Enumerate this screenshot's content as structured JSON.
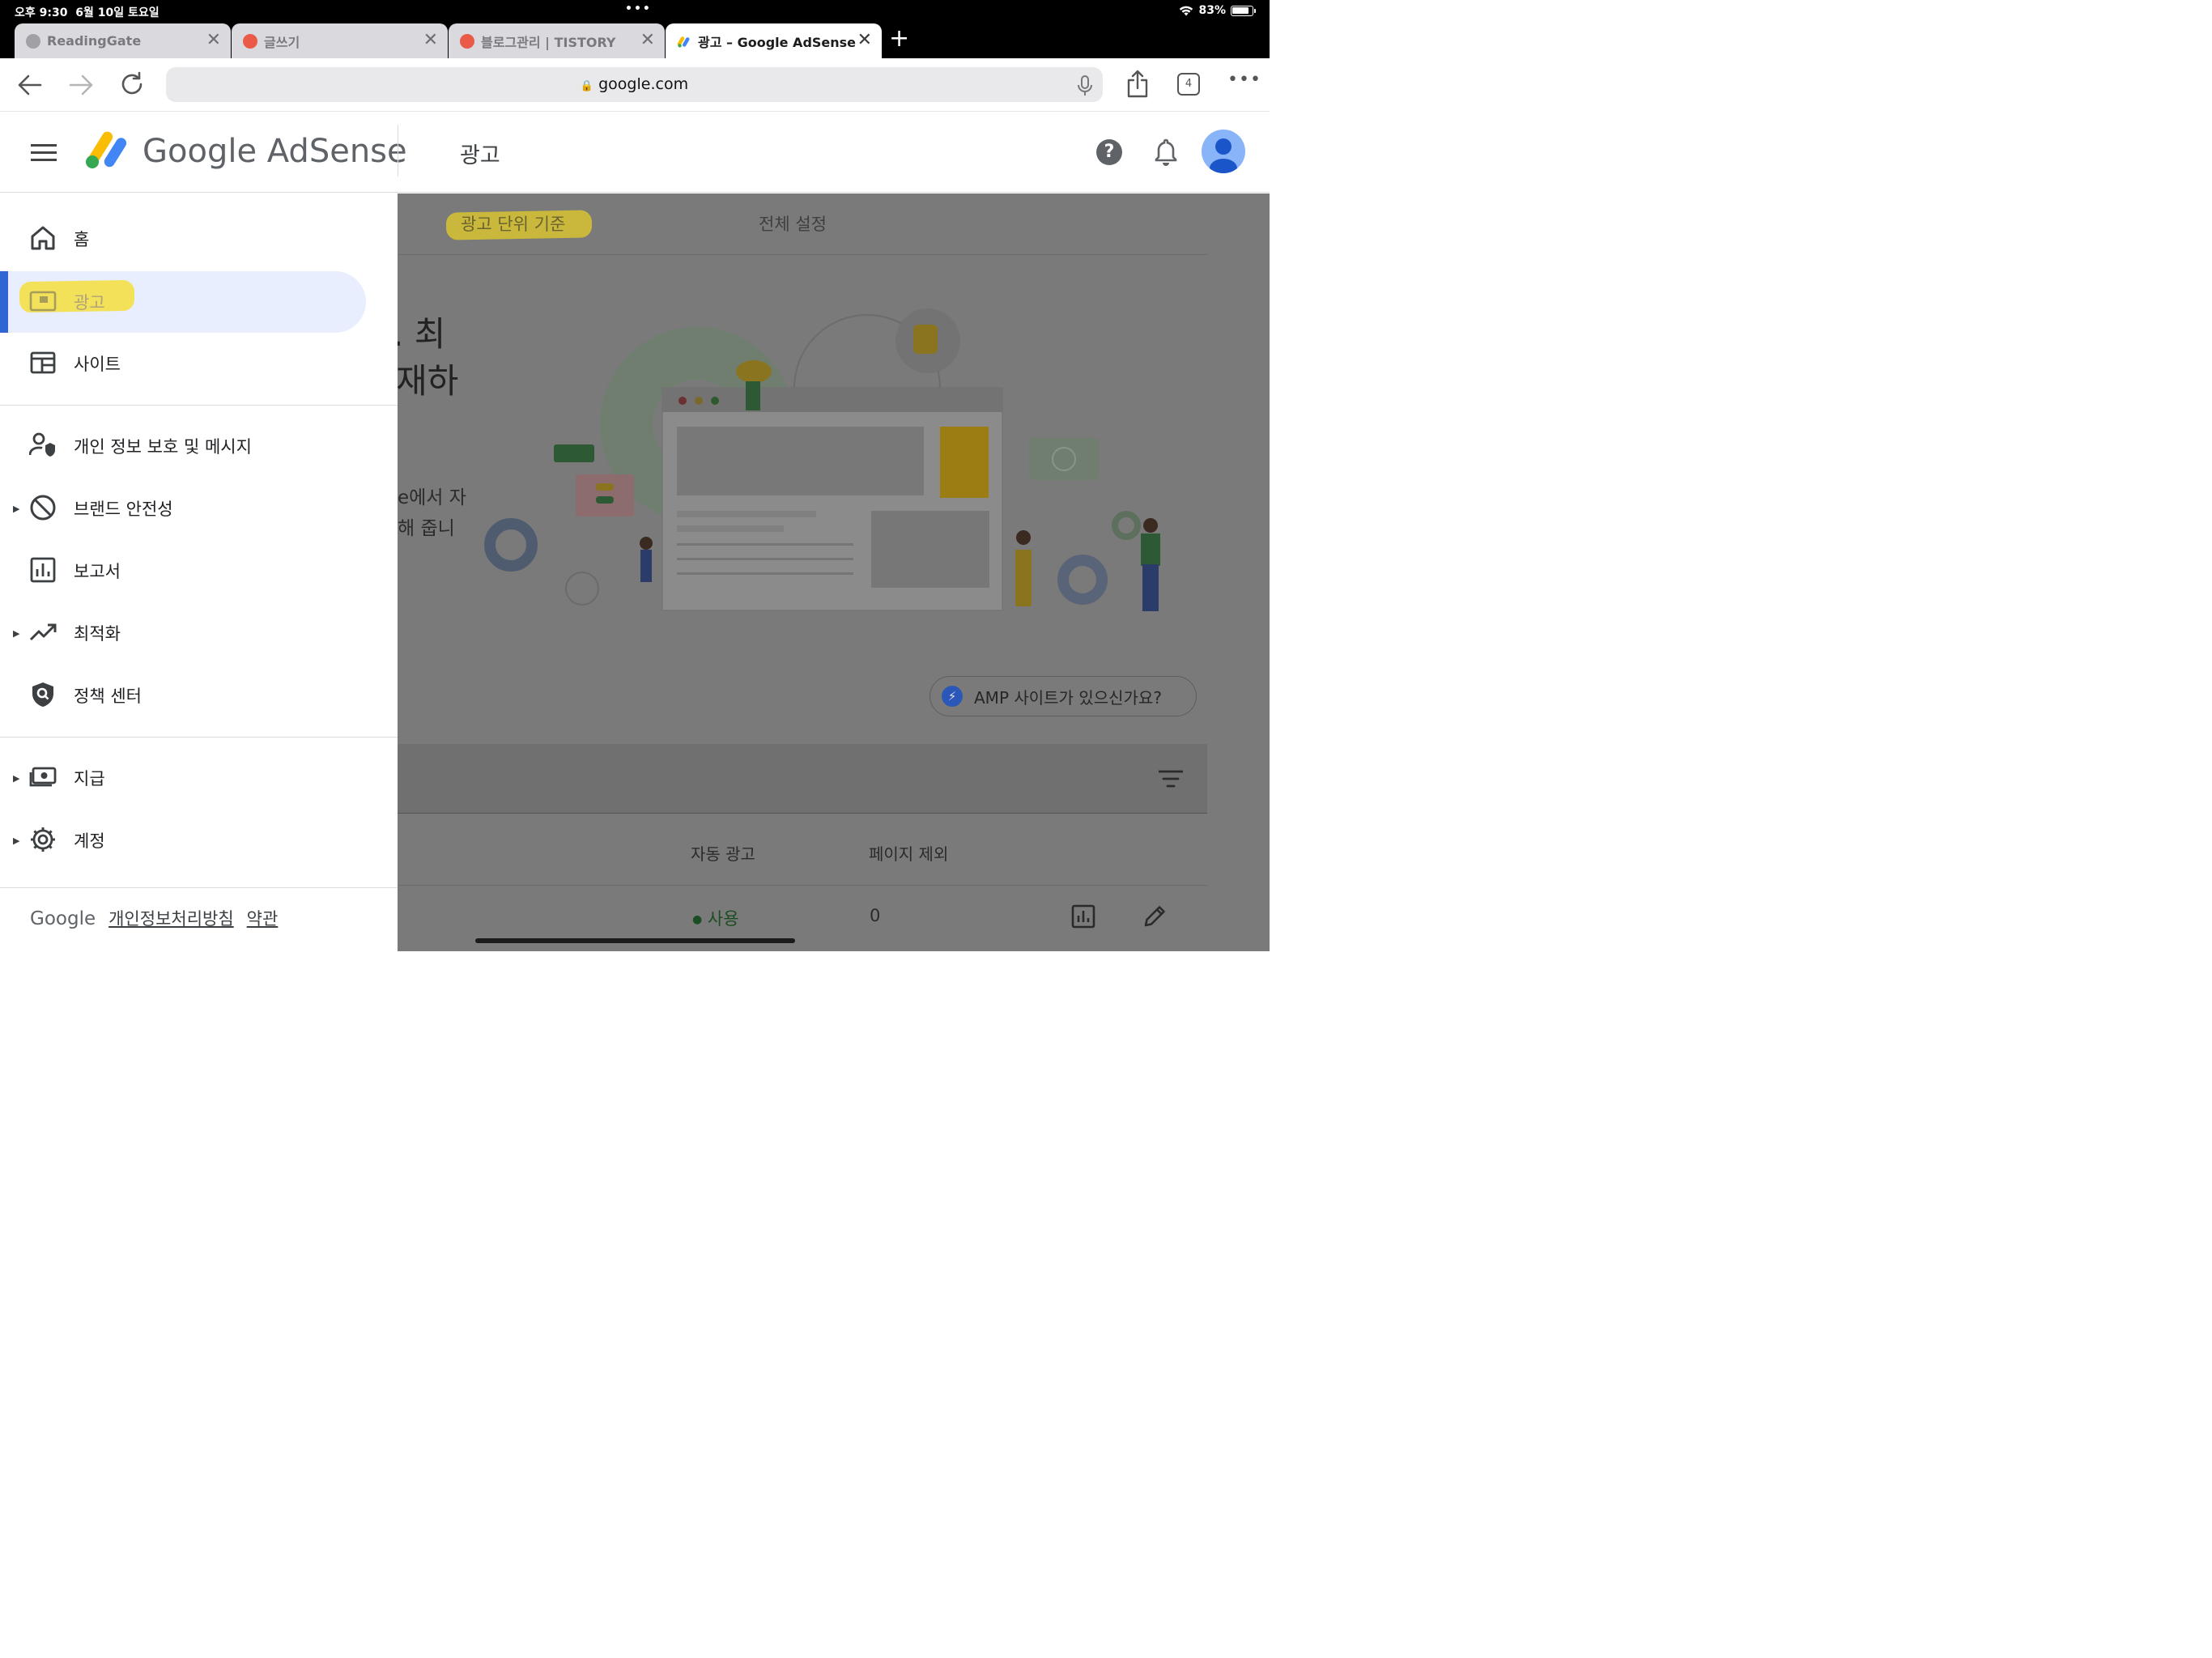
{
  "status_bar": {
    "time": "오후 9:30",
    "date": "6월 10일 토요일",
    "battery": "83%",
    "dots": "•••"
  },
  "browser_tabs": [
    {
      "title": "ReadingGate",
      "favicon": "globe-icon",
      "active": false
    },
    {
      "title": "글쓰기",
      "favicon": "tistory-icon",
      "active": false
    },
    {
      "title": "블로그관리 | TISTORY",
      "favicon": "tistory-icon",
      "active": false
    },
    {
      "title": "광고 – Google AdSense",
      "favicon": "adsense-icon",
      "active": true
    }
  ],
  "toolbar": {
    "url": "google.com",
    "tab_count": "4"
  },
  "header": {
    "brand": "Google AdSense",
    "page_title": "광고"
  },
  "sidebar": {
    "items": [
      {
        "label": "홈",
        "icon": "home-icon",
        "expandable": false
      },
      {
        "label": "광고",
        "icon": "ads-icon",
        "expandable": false,
        "selected": true
      },
      {
        "label": "사이트",
        "icon": "sites-icon",
        "expandable": false
      },
      {
        "label": "개인 정보 보호 및 메시지",
        "icon": "privacy-icon",
        "expandable": false
      },
      {
        "label": "브랜드 안전성",
        "icon": "block-icon",
        "expandable": true
      },
      {
        "label": "보고서",
        "icon": "reports-icon",
        "expandable": false
      },
      {
        "label": "최적화",
        "icon": "trending-icon",
        "expandable": true
      },
      {
        "label": "정책 센터",
        "icon": "policy-icon",
        "expandable": false
      },
      {
        "label": "지급",
        "icon": "payments-icon",
        "expandable": true
      },
      {
        "label": "계정",
        "icon": "settings-icon",
        "expandable": true
      }
    ],
    "footer": {
      "brand": "Google",
      "privacy_link": "개인정보처리방침",
      "terms_link": "약관"
    }
  },
  "main": {
    "tabs": [
      "광고 단위 기준",
      "전체 설정"
    ],
    "hero_line1": ". 최",
    "hero_line2": "재하",
    "hero_sub1": "e에서 자",
    "hero_sub2": "해 줍니",
    "amp_button": "AMP 사이트가 있으신가요?",
    "table": {
      "columns": [
        "자동 광고",
        "페이지 제외"
      ],
      "rows": [
        {
          "auto_ads": "사용",
          "excluded_pages": "0"
        }
      ]
    }
  },
  "colors": {
    "accent_blue": "#2f66d4",
    "selected_bg": "#e8eefd",
    "highlighter": "#e6cd28",
    "status_green": "#1e8e3e"
  }
}
